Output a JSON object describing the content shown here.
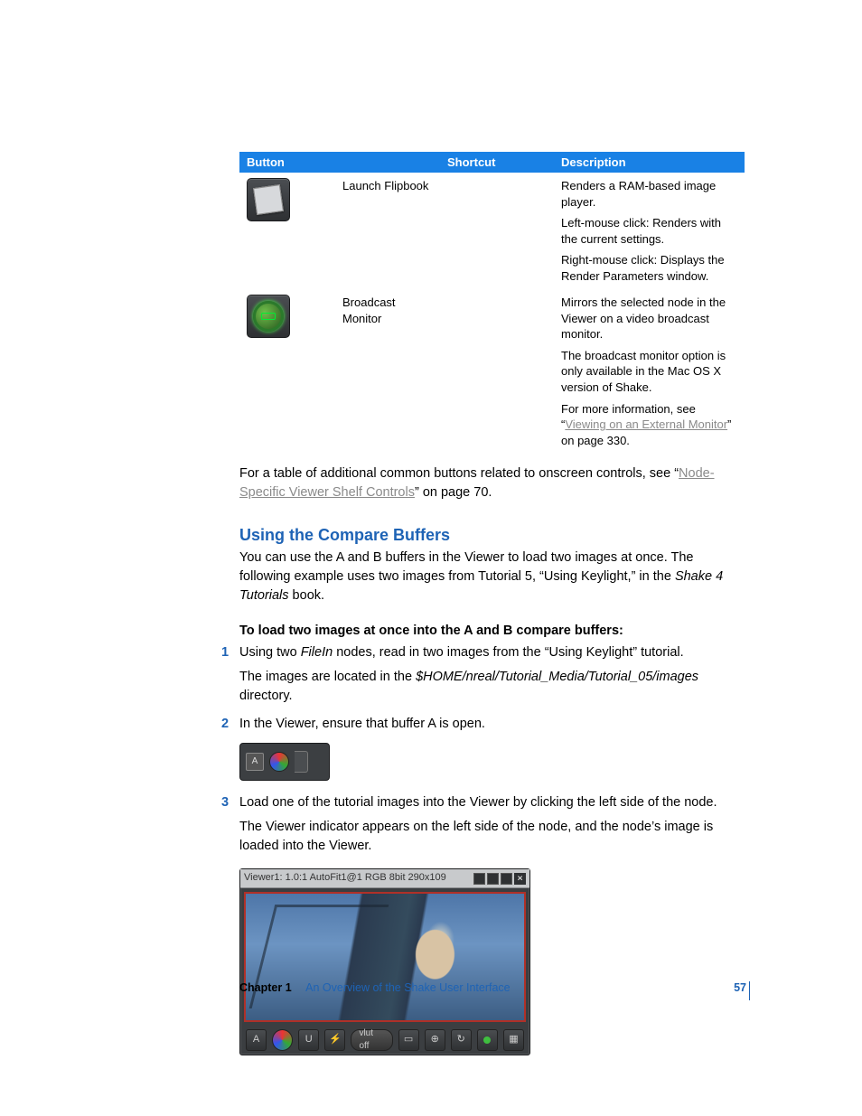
{
  "table": {
    "headers": {
      "c1": "Button",
      "c2": "Shortcut",
      "c3": "Description"
    },
    "rows": [
      {
        "name": "Launch Flipbook",
        "desc": [
          "Renders a RAM-based image player.",
          "Left-mouse click:  Renders with the current settings.",
          "Right-mouse click:  Displays the Render Parameters window."
        ]
      },
      {
        "name": "Broadcast Monitor",
        "desc": [
          "Mirrors the selected node in the Viewer on a video broadcast monitor.",
          "The broadcast monitor option is only available in the Mac OS X version of Shake."
        ],
        "more_prefix": "For more information, see “",
        "more_link": "Viewing on an External Monitor",
        "more_suffix": "” on page 330."
      }
    ]
  },
  "para1_a": "For a table of additional common buttons related to onscreen controls, see “",
  "para1_link": "Node-Specific Viewer Shelf Controls",
  "para1_b": "” on page 70.",
  "section_title": "Using the Compare Buffers",
  "para2_a": "You can use the A and B buffers in the Viewer to load two images at once. The following example uses two images from Tutorial 5, “Using Keylight,” in the ",
  "para2_em": "Shake 4 Tutorials",
  "para2_b": " book.",
  "lead": "To load two images at once into the A and B compare buffers:",
  "steps": {
    "s1": {
      "num": "1",
      "a": "Using two ",
      "em": "FileIn",
      "b": " nodes, read in two images from the “Using Keylight” tutorial.",
      "sub_a": "The images are located in the ",
      "sub_em": "$HOME/nreal/Tutorial_Media/Tutorial_05/images",
      "sub_b": " directory."
    },
    "s2": {
      "num": "2",
      "text": "In the Viewer, ensure that buffer A is open."
    },
    "s3": {
      "num": "3",
      "text": "Load one of the tutorial images into the Viewer by clicking the left side of the node.",
      "sub": "The Viewer indicator appears on the left side of the node, and the node’s image is loaded into the Viewer."
    }
  },
  "buffer_label": "A",
  "viewer": {
    "title": "Viewer1: 1.0:1 AutoFit1@1 RGB 8bit 290x109",
    "vlut": "vlut off",
    "chipA": "A",
    "chipU": "U"
  },
  "footer": {
    "chapter_label": "Chapter 1",
    "chapter_title": "An Overview of the Shake User Interface",
    "page": "57"
  }
}
